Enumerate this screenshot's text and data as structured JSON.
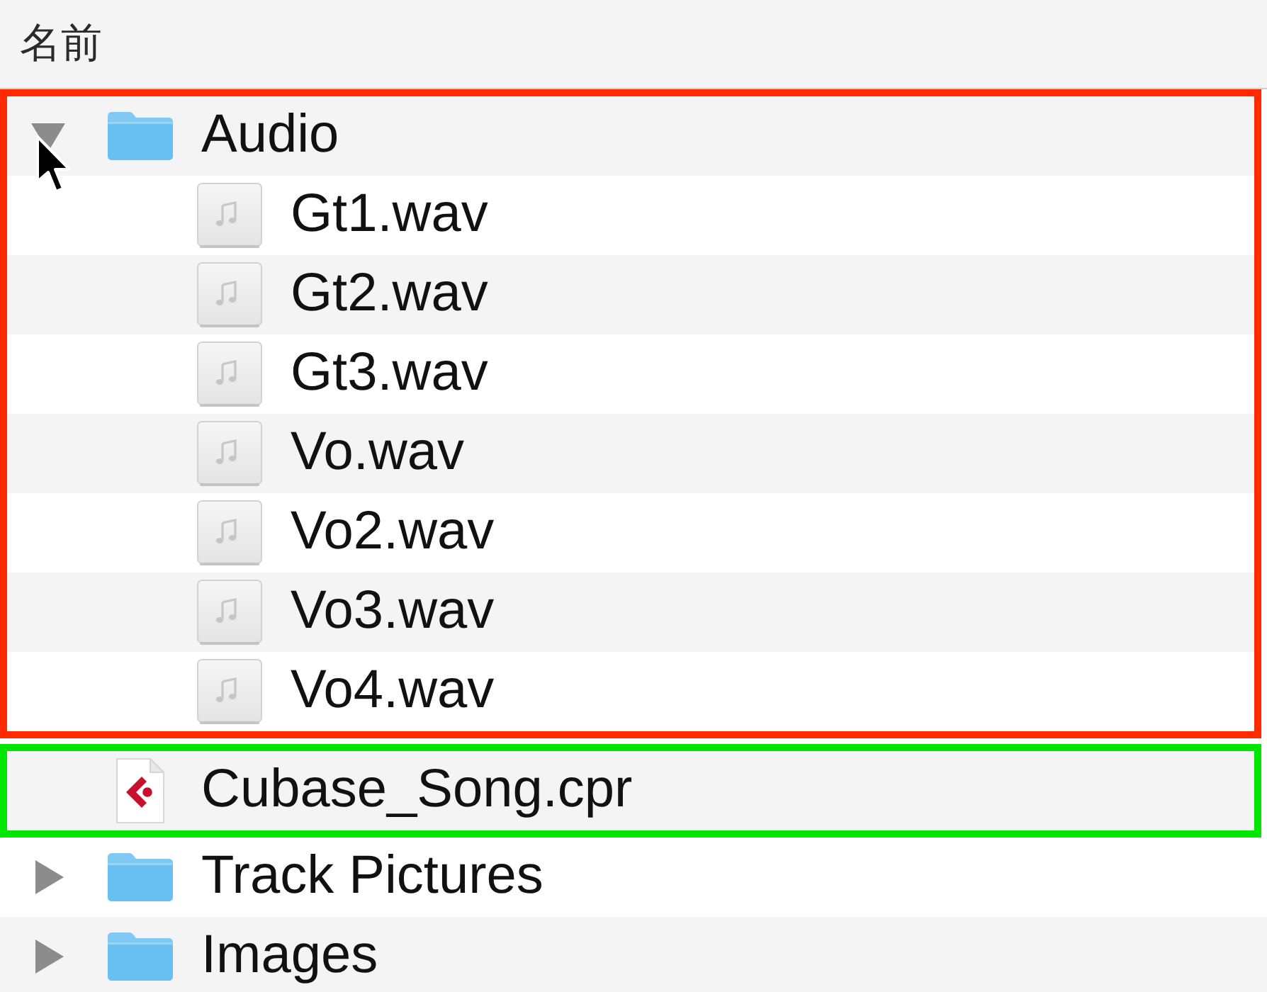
{
  "column_header": "名前",
  "items": [
    {
      "kind": "folder",
      "name": "Audio",
      "expanded": true,
      "color": "#ff2a00",
      "children": [
        {
          "kind": "audio",
          "name": "Gt1.wav"
        },
        {
          "kind": "audio",
          "name": "Gt2.wav"
        },
        {
          "kind": "audio",
          "name": "Gt3.wav"
        },
        {
          "kind": "audio",
          "name": "Vo.wav"
        },
        {
          "kind": "audio",
          "name": "Vo2.wav"
        },
        {
          "kind": "audio",
          "name": "Vo3.wav"
        },
        {
          "kind": "audio",
          "name": "Vo4.wav"
        }
      ]
    },
    {
      "kind": "project",
      "name": "Cubase_Song.cpr",
      "color": "#00e600"
    },
    {
      "kind": "folder",
      "name": "Track Pictures",
      "expanded": false
    },
    {
      "kind": "folder",
      "name": "Images",
      "expanded": false
    }
  ]
}
